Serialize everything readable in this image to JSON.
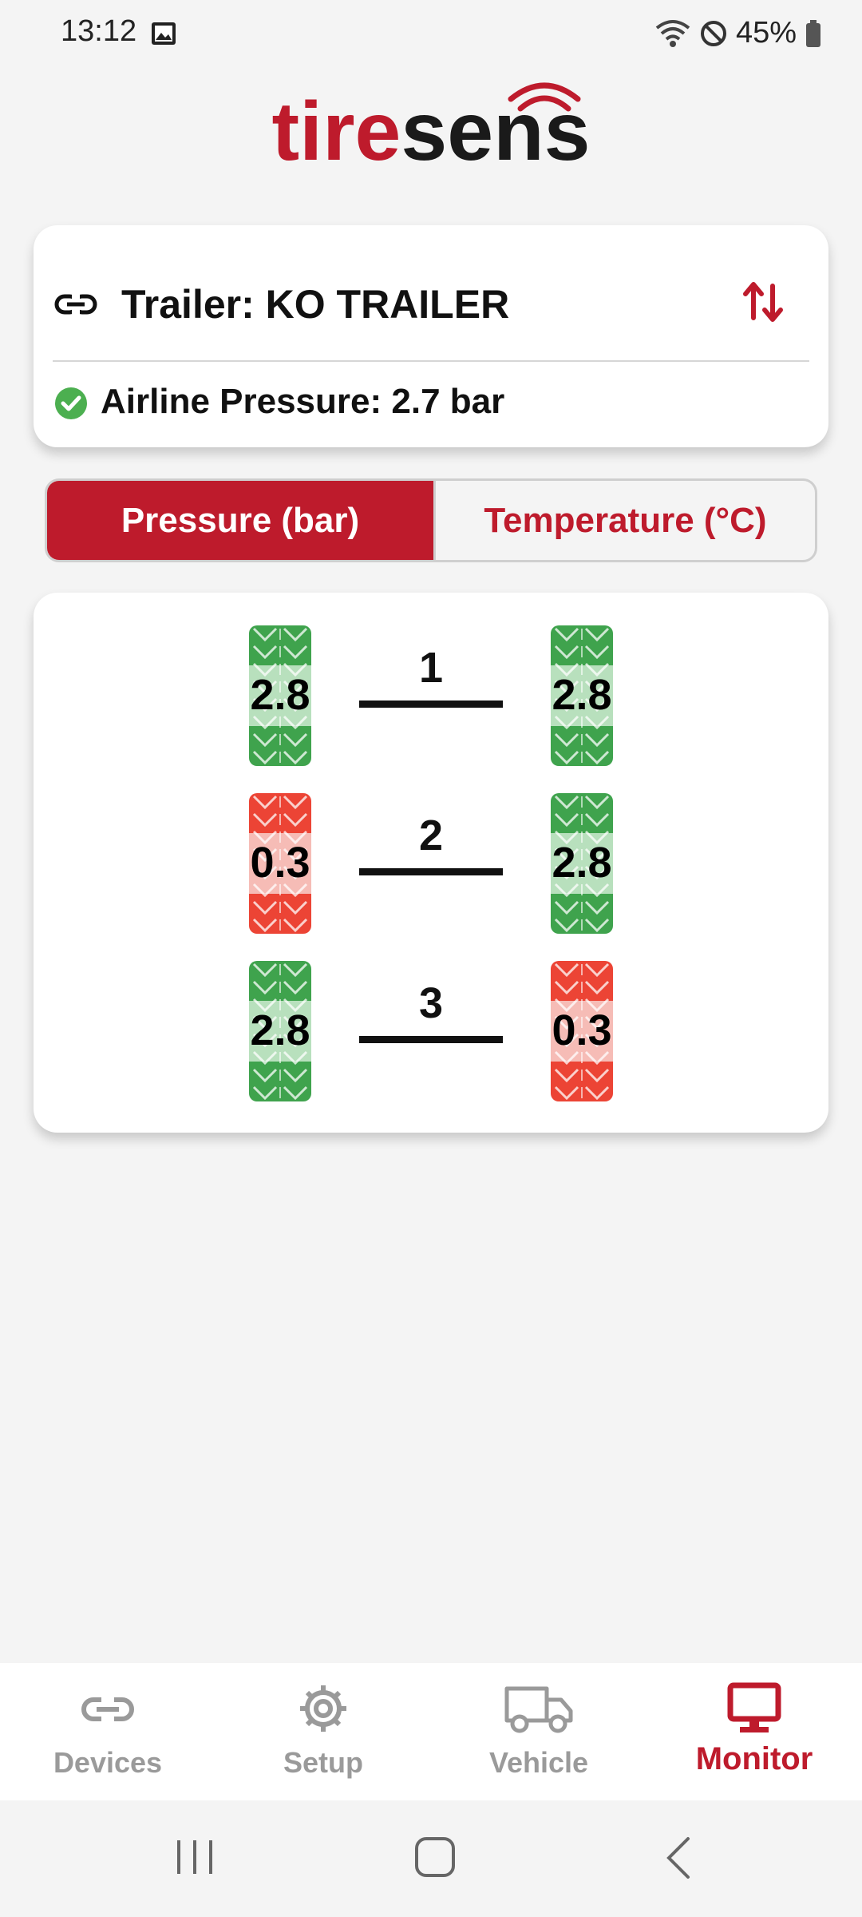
{
  "status_bar": {
    "time": "13:12",
    "battery": "45%"
  },
  "app": {
    "logo_prefix": "tire",
    "logo_suffix": "sens"
  },
  "trailer": {
    "title": "Trailer: KO TRAILER",
    "airline": "Airline Pressure: 2.7 bar"
  },
  "tabs": [
    {
      "label": "Pressure (bar)",
      "active": true
    },
    {
      "label": "Temperature (°C)",
      "active": false
    }
  ],
  "axles": [
    {
      "number": "1",
      "left": {
        "value": "2.8",
        "status": "ok"
      },
      "right": {
        "value": "2.8",
        "status": "ok"
      }
    },
    {
      "number": "2",
      "left": {
        "value": "0.3",
        "status": "alert"
      },
      "right": {
        "value": "2.8",
        "status": "ok"
      }
    },
    {
      "number": "3",
      "left": {
        "value": "2.8",
        "status": "ok"
      },
      "right": {
        "value": "0.3",
        "status": "alert"
      }
    }
  ],
  "nav": [
    {
      "label": "Devices",
      "icon": "link-icon"
    },
    {
      "label": "Setup",
      "icon": "gear-icon"
    },
    {
      "label": "Vehicle",
      "icon": "truck-icon"
    },
    {
      "label": "Monitor",
      "icon": "monitor-icon",
      "active": true
    }
  ],
  "colors": {
    "brand_red": "#be1b2c",
    "tire_ok": "#3fa34d",
    "tire_alert": "#ec4435",
    "check_green": "#4caf50"
  }
}
